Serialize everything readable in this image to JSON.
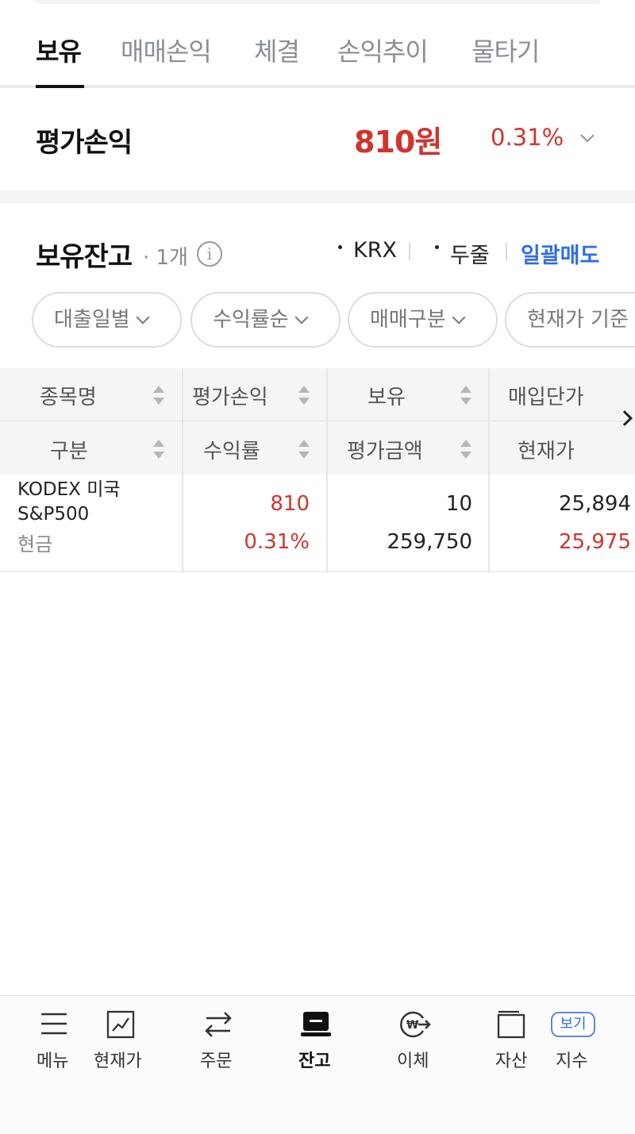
{
  "tabs": [
    "보유",
    "매매손익",
    "체결",
    "손익추이",
    "물타기"
  ],
  "summary": {
    "label": "평가손익",
    "amount": "810원",
    "rate": "0.31%"
  },
  "holdings": {
    "title": "보유잔고",
    "count": "· 1개",
    "info_icon": "i",
    "options": [
      "KRX",
      "두줄"
    ],
    "bulk_sell": "일괄매도"
  },
  "filters": [
    "대출일별",
    "수익률순",
    "매매구분",
    "현재가 기준"
  ],
  "table": {
    "header_row1": [
      "종목명",
      "평가손익",
      "보유",
      "매입단가"
    ],
    "header_row2": [
      "구분",
      "수익률",
      "평가금액",
      "현재가"
    ],
    "rows": [
      {
        "name": "KODEX 미국S&P500",
        "category": "현금",
        "pnl": "810",
        "rate": "0.31%",
        "qty": "10",
        "eval_amount": "259,750",
        "avg_price": "25,894",
        "current_price": "25,975"
      }
    ]
  },
  "bottom_nav": {
    "items": [
      "메뉴",
      "현재가",
      "주문",
      "잔고",
      "이체",
      "자산",
      "지수"
    ],
    "badge": "보기",
    "icons": [
      "menu-icon",
      "chart-icon",
      "transfer-arrows-icon",
      "laptop-icon",
      "won-send-icon",
      "wallet-icon"
    ]
  },
  "colors": {
    "positive": "#d0352d",
    "link": "#2f6ee3"
  }
}
